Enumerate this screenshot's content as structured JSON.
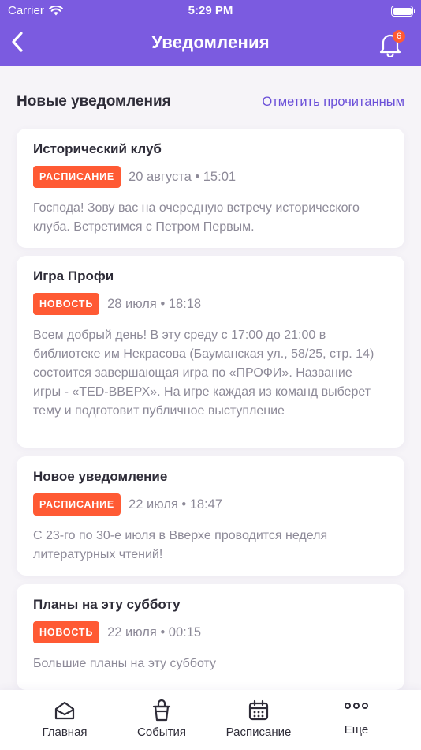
{
  "status_bar": {
    "carrier": "Carrier",
    "time": "5:29 PM"
  },
  "nav": {
    "title": "Уведомления",
    "bell_count": "6"
  },
  "section": {
    "title": "Новые уведомления",
    "mark_read": "Отметить прочитанным"
  },
  "notifications": [
    {
      "title": "Исторический клуб",
      "tag": "РАСПИСАНИЕ",
      "date": "20 августа • 15:01",
      "text": "Господа! Зову вас на очередную встречу исторического клуба. Встретимся с Петром Первым."
    },
    {
      "title": "Игра Профи",
      "tag": "НОВОСТЬ",
      "date": "28 июля • 18:18",
      "text": "Всем добрый день! В эту среду с 17:00 до 21:00 в библиотеке им Некрасова (Бауманская ул., 58/25, стр. 14) состоится завершающая игра по «ПРОФИ». Название игры - «TED-ВВЕРХ». На игре каждая из команд выберет тему и подготовит публичное выступление"
    },
    {
      "title": "Новое уведомление",
      "tag": "РАСПИСАНИЕ",
      "date": "22 июля • 18:47",
      "text": "С 23-го по 30-е июля в Вверхе проводится неделя литературных чтений!"
    },
    {
      "title": "Планы на эту субботу",
      "tag": "НОВОСТЬ",
      "date": "22 июля • 00:15",
      "text": "Большие планы на эту субботу"
    }
  ],
  "tabbar": [
    {
      "label": "Главная",
      "icon": "home-icon"
    },
    {
      "label": "События",
      "icon": "cup-icon"
    },
    {
      "label": "Расписание",
      "icon": "calendar-icon"
    },
    {
      "label": "Еще",
      "icon": "more-icon"
    }
  ],
  "colors": {
    "header": "#7b5be0",
    "badge": "#ff5a34",
    "link": "#6a4fd8",
    "background": "#f6f4f8"
  }
}
